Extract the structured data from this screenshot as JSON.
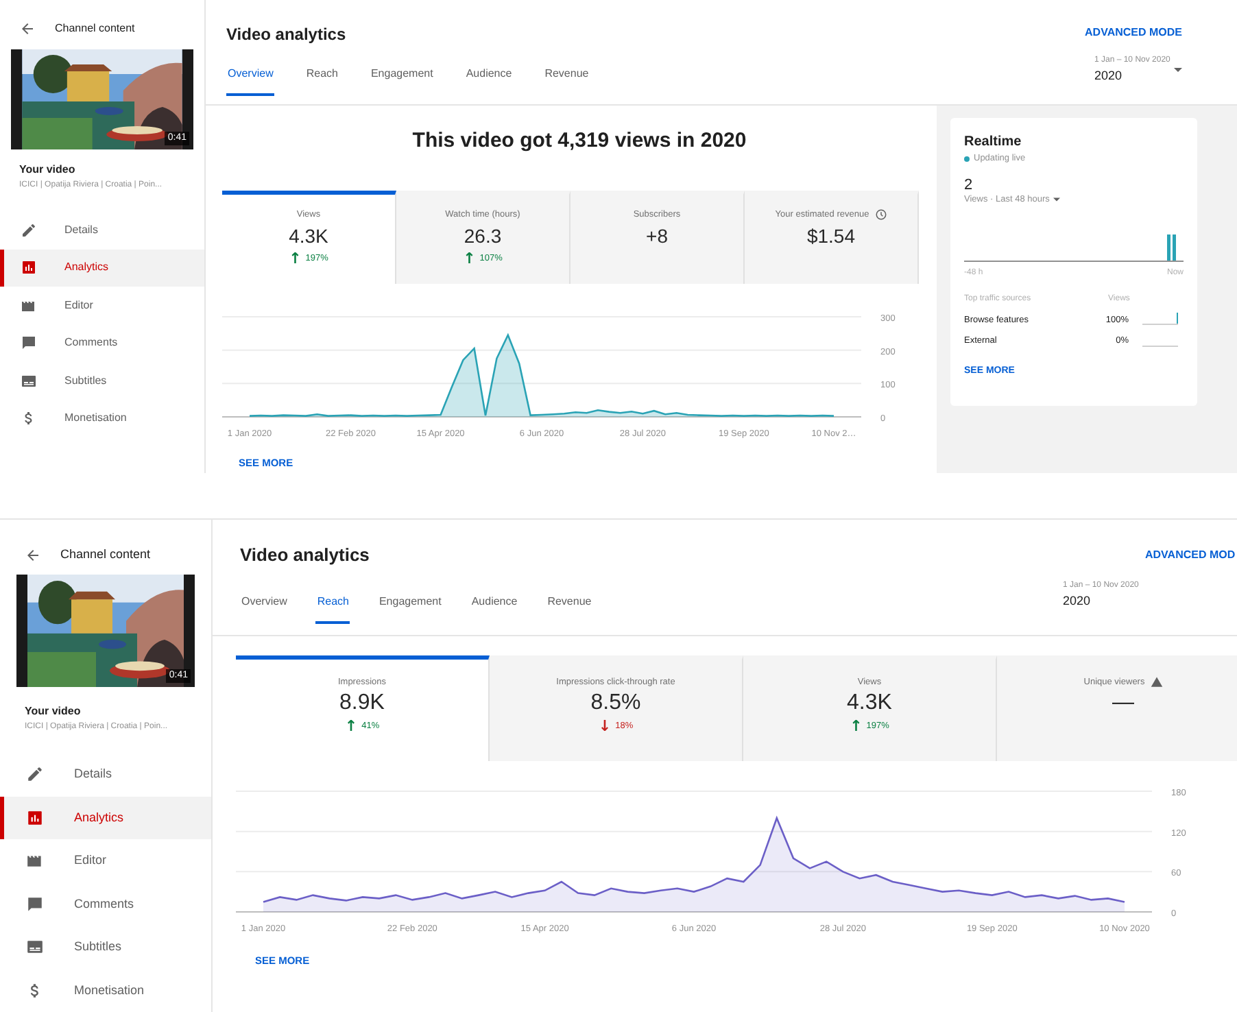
{
  "screens": [
    {
      "sidebar": {
        "back_label": "Channel content",
        "duration": "0:41",
        "video_label": "Your video",
        "video_title": "ICICI | Opatija Riviera | Croatia | Poin...",
        "items": [
          {
            "label": "Details",
            "selected": false
          },
          {
            "label": "Analytics",
            "selected": true
          },
          {
            "label": "Editor",
            "selected": false
          },
          {
            "label": "Comments",
            "selected": false
          },
          {
            "label": "Subtitles",
            "selected": false
          },
          {
            "label": "Monetisation",
            "selected": false
          }
        ]
      },
      "header": {
        "title": "Video analytics",
        "advanced_mode": "ADVANCED MODE",
        "date_range": "1 Jan – 10 Nov 2020",
        "period": "2020"
      },
      "tabs": [
        {
          "label": "Overview",
          "selected": true
        },
        {
          "label": "Reach",
          "selected": false
        },
        {
          "label": "Engagement",
          "selected": false
        },
        {
          "label": "Audience",
          "selected": false
        },
        {
          "label": "Revenue",
          "selected": false
        }
      ],
      "headline": "This video got 4,319 views in 2020",
      "metrics": [
        {
          "label": "Views",
          "value": "4.3K",
          "arrow": "↑",
          "change": "197%",
          "color": "#0b8043",
          "selected": true,
          "kind": "plain"
        },
        {
          "label": "Watch time (hours)",
          "value": "26.3",
          "arrow": "↑",
          "change": "107%",
          "color": "#0b8043",
          "selected": false,
          "kind": "plain"
        },
        {
          "label": "Subscribers",
          "value": "+8",
          "selected": false,
          "kind": "plain"
        },
        {
          "label": "Your estimated revenue",
          "value": "$1.54",
          "selected": false,
          "kind": "timed"
        }
      ],
      "chart_data": {
        "type": "area",
        "series": [
          {
            "color": "#2aa3b5",
            "values": [
              3,
              4,
              3,
              5,
              4,
              3,
              8,
              3,
              4,
              5,
              3,
              4,
              3,
              4,
              3,
              4,
              5,
              6,
              90,
              170,
              205,
              4,
              175,
              245,
              160,
              5,
              6,
              8,
              10,
              14,
              12,
              20,
              15,
              12,
              16,
              10,
              18,
              8,
              12,
              6,
              5,
              4,
              3,
              4,
              3,
              4,
              3,
              4,
              3,
              4,
              3,
              4,
              3
            ]
          }
        ],
        "categories": [
          "1 Jan 2020",
          null,
          null,
          null,
          null,
          null,
          null,
          null,
          null,
          "22 Feb 2020",
          null,
          null,
          null,
          null,
          null,
          null,
          null,
          "15 Apr 2020",
          null,
          null,
          null,
          null,
          null,
          null,
          null,
          null,
          "6 Jun 2020",
          null,
          null,
          null,
          null,
          null,
          null,
          null,
          null,
          "28 Jul 2020",
          null,
          null,
          null,
          null,
          null,
          null,
          null,
          null,
          "19 Sep 2020",
          null,
          null,
          null,
          null,
          null,
          null,
          null,
          "10 Nov 2…"
        ],
        "ylim": [
          0,
          300
        ],
        "yticks": [
          0,
          100,
          200,
          300
        ]
      },
      "see_more": "SEE MORE",
      "realtime": {
        "title": "Realtime",
        "status": "Updating live",
        "count": "2",
        "metric": "Views · Last 48 hours",
        "start_label": "-48 h",
        "end_label": "Now",
        "sources_heading": "Top traffic sources",
        "views_heading": "Views",
        "sources": [
          {
            "label": "Browse features",
            "share": "100%",
            "level": 1
          },
          {
            "label": "External",
            "share": "0%",
            "level": 0
          }
        ],
        "see_more": "SEE MORE"
      }
    },
    {
      "sidebar": {
        "back_label": "Channel content",
        "duration": "0:41",
        "video_label": "Your video",
        "video_title": "ICICI | Opatija Riviera | Croatia | Poin...",
        "items": [
          {
            "label": "Details",
            "selected": false
          },
          {
            "label": "Analytics",
            "selected": true
          },
          {
            "label": "Editor",
            "selected": false
          },
          {
            "label": "Comments",
            "selected": false
          },
          {
            "label": "Subtitles",
            "selected": false
          },
          {
            "label": "Monetisation",
            "selected": false
          }
        ]
      },
      "header": {
        "title": "Video analytics",
        "advanced_mode": "ADVANCED MOD",
        "date_range": "1 Jan – 10 Nov 2020",
        "period": "2020"
      },
      "tabs": [
        {
          "label": "Overview",
          "selected": false
        },
        {
          "label": "Reach",
          "selected": true
        },
        {
          "label": "Engagement",
          "selected": false
        },
        {
          "label": "Audience",
          "selected": false
        },
        {
          "label": "Revenue",
          "selected": false
        }
      ],
      "metrics": [
        {
          "label": "Impressions",
          "value": "8.9K",
          "arrow": "↑",
          "change": "41%",
          "color": "#0b8043",
          "selected": true,
          "kind": "plain"
        },
        {
          "label": "Impressions click-through rate",
          "value": "8.5%",
          "arrow": "↓",
          "change": "18%",
          "color": "#c5221f",
          "selected": false,
          "kind": "plain"
        },
        {
          "label": "Views",
          "value": "4.3K",
          "arrow": "↑",
          "change": "197%",
          "color": "#0b8043",
          "selected": false,
          "kind": "plain"
        },
        {
          "label": "Unique viewers",
          "value": "—",
          "selected": false,
          "kind": "warning"
        }
      ],
      "chart_data": {
        "type": "area",
        "series": [
          {
            "color": "#6b5fc7",
            "values": [
              15,
              22,
              18,
              25,
              20,
              17,
              22,
              20,
              25,
              18,
              22,
              28,
              20,
              25,
              30,
              22,
              28,
              32,
              45,
              28,
              25,
              35,
              30,
              28,
              32,
              35,
              30,
              38,
              50,
              45,
              70,
              140,
              80,
              65,
              75,
              60,
              50,
              55,
              45,
              40,
              35,
              30,
              32,
              28,
              25,
              30,
              22,
              25,
              20,
              24,
              18,
              20,
              15
            ]
          }
        ],
        "categories": [
          "1 Jan 2020",
          null,
          null,
          null,
          null,
          null,
          null,
          null,
          null,
          "22 Feb 2020",
          null,
          null,
          null,
          null,
          null,
          null,
          null,
          "15 Apr 2020",
          null,
          null,
          null,
          null,
          null,
          null,
          null,
          null,
          "6 Jun 2020",
          null,
          null,
          null,
          null,
          null,
          null,
          null,
          null,
          "28 Jul 2020",
          null,
          null,
          null,
          null,
          null,
          null,
          null,
          null,
          "19 Sep 2020",
          null,
          null,
          null,
          null,
          null,
          null,
          null,
          "10 Nov 2020"
        ],
        "ylim": [
          0,
          180
        ],
        "yticks": [
          0,
          60,
          120,
          180
        ]
      },
      "see_more": "SEE MORE"
    }
  ]
}
